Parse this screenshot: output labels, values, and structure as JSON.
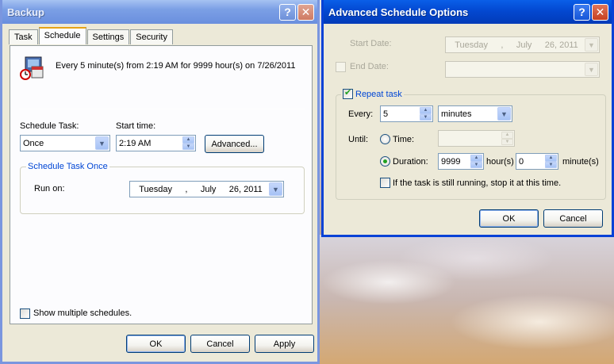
{
  "backup": {
    "title": "Backup",
    "tabs": [
      "Task",
      "Schedule",
      "Settings",
      "Security"
    ],
    "summary": "Every 5 minute(s) from 2:19 AM for 9999 hour(s) on 7/26/2011",
    "schedule_task_label": "Schedule Task:",
    "schedule_task_value": "Once",
    "start_time_label": "Start time:",
    "start_time_value": "2:19 AM",
    "advanced_button": "Advanced...",
    "group_title": "Schedule Task Once",
    "run_on_label": "Run on:",
    "run_on_date": {
      "day": "Tuesday",
      "sep": ",",
      "month": "July",
      "date": "26, 2011"
    },
    "show_multiple": "Show multiple schedules.",
    "ok": "OK",
    "cancel": "Cancel",
    "apply": "Apply"
  },
  "advanced": {
    "title": "Advanced Schedule Options",
    "start_date_label": "Start Date:",
    "start_date": {
      "day": "Tuesday",
      "sep": ",",
      "month": "July",
      "date": "26, 2011"
    },
    "end_date_label": "End Date:",
    "repeat_task_label": "Repeat task",
    "every_label": "Every:",
    "every_value": "5",
    "unit_value": "minutes",
    "until_label": "Until:",
    "time_label": "Time:",
    "duration_label": "Duration:",
    "duration_hours": "9999",
    "hours_label": "hour(s)",
    "duration_minutes": "0",
    "minutes_label": "minute(s)",
    "stop_label": "If the task is still running, stop it at this time.",
    "ok": "OK",
    "cancel": "Cancel"
  },
  "colors": {
    "accent": "#0046d5",
    "title_active": "#0348d1",
    "title_inactive": "#7b9fe5"
  }
}
